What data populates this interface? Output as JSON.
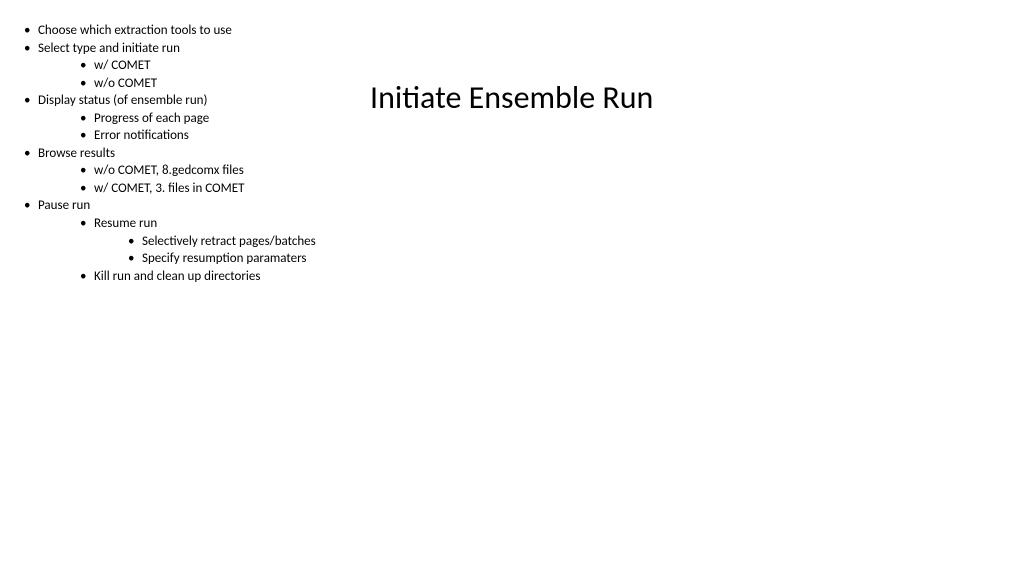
{
  "title": "Initiate Ensemble Run",
  "outline": {
    "i0": "Choose which extraction tools to use",
    "i1": "Select type and initiate run",
    "i1_0": "w/ COMET",
    "i1_1": "w/o COMET",
    "i2": "Display status (of ensemble run)",
    "i2_0": "Progress of each page",
    "i2_1": "Error notifications",
    "i3": "Browse results",
    "i3_0": "w/o COMET, 8.gedcomx files",
    "i3_1": "w/ COMET, 3. files in COMET",
    "i4": "Pause run",
    "i4_0": "Resume run",
    "i4_0_0": "Selectively retract pages/batches",
    "i4_0_1": "Specify resumption paramaters",
    "i4_1": "Kill run and clean up directories"
  }
}
